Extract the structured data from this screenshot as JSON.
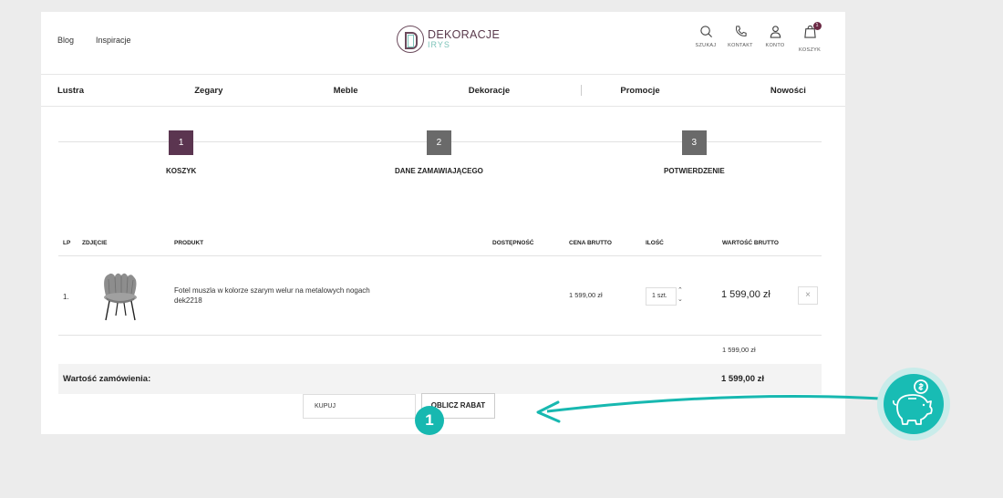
{
  "header": {
    "links": [
      "Blog",
      "Inspiracje"
    ],
    "logo": {
      "line1": "DEKORACJE",
      "line2": "IRYS"
    },
    "icons": [
      {
        "name": "search-icon",
        "label": "SZUKAJ"
      },
      {
        "name": "phone-icon",
        "label": "KONTAKT"
      },
      {
        "name": "user-icon",
        "label": "KONTO"
      },
      {
        "name": "bag-icon",
        "label": "KOSZYK"
      }
    ],
    "cart_count": "1"
  },
  "menu": [
    "Lustra",
    "Zegary",
    "Meble",
    "Dekoracje",
    "Promocje",
    "Nowości"
  ],
  "steps": [
    {
      "num": "1",
      "label": "KOSZYK"
    },
    {
      "num": "2",
      "label": "DANE ZAMAWIAJĄCEGO"
    },
    {
      "num": "3",
      "label": "POTWIERDZENIE"
    }
  ],
  "table": {
    "headers": [
      "LP",
      "ZDJĘCIE",
      "PRODUKT",
      "DOSTĘPNOŚĆ",
      "CENA BRUTTO",
      "ILOŚĆ",
      "WARTOŚĆ BRUTTO"
    ],
    "row": {
      "lp": "1.",
      "product_name": "Fotel muszla w kolorze szarym welur na metalowych nogach",
      "product_code": "dek2218",
      "price": "1 599,00 zł",
      "quantity": "1 szt.",
      "value": "1 599,00 zł",
      "remove": "×"
    },
    "subtotal": "1 599,00 zł",
    "total_label": "Wartość zamówienia:",
    "total_value": "1 599,00 zł"
  },
  "coupon": {
    "value": "KUPUJ",
    "button": "OBLICZ RABAT"
  },
  "annotation": {
    "marker": "1"
  },
  "colors": {
    "accent": "#5b3550",
    "teal": "#17b8b0"
  }
}
